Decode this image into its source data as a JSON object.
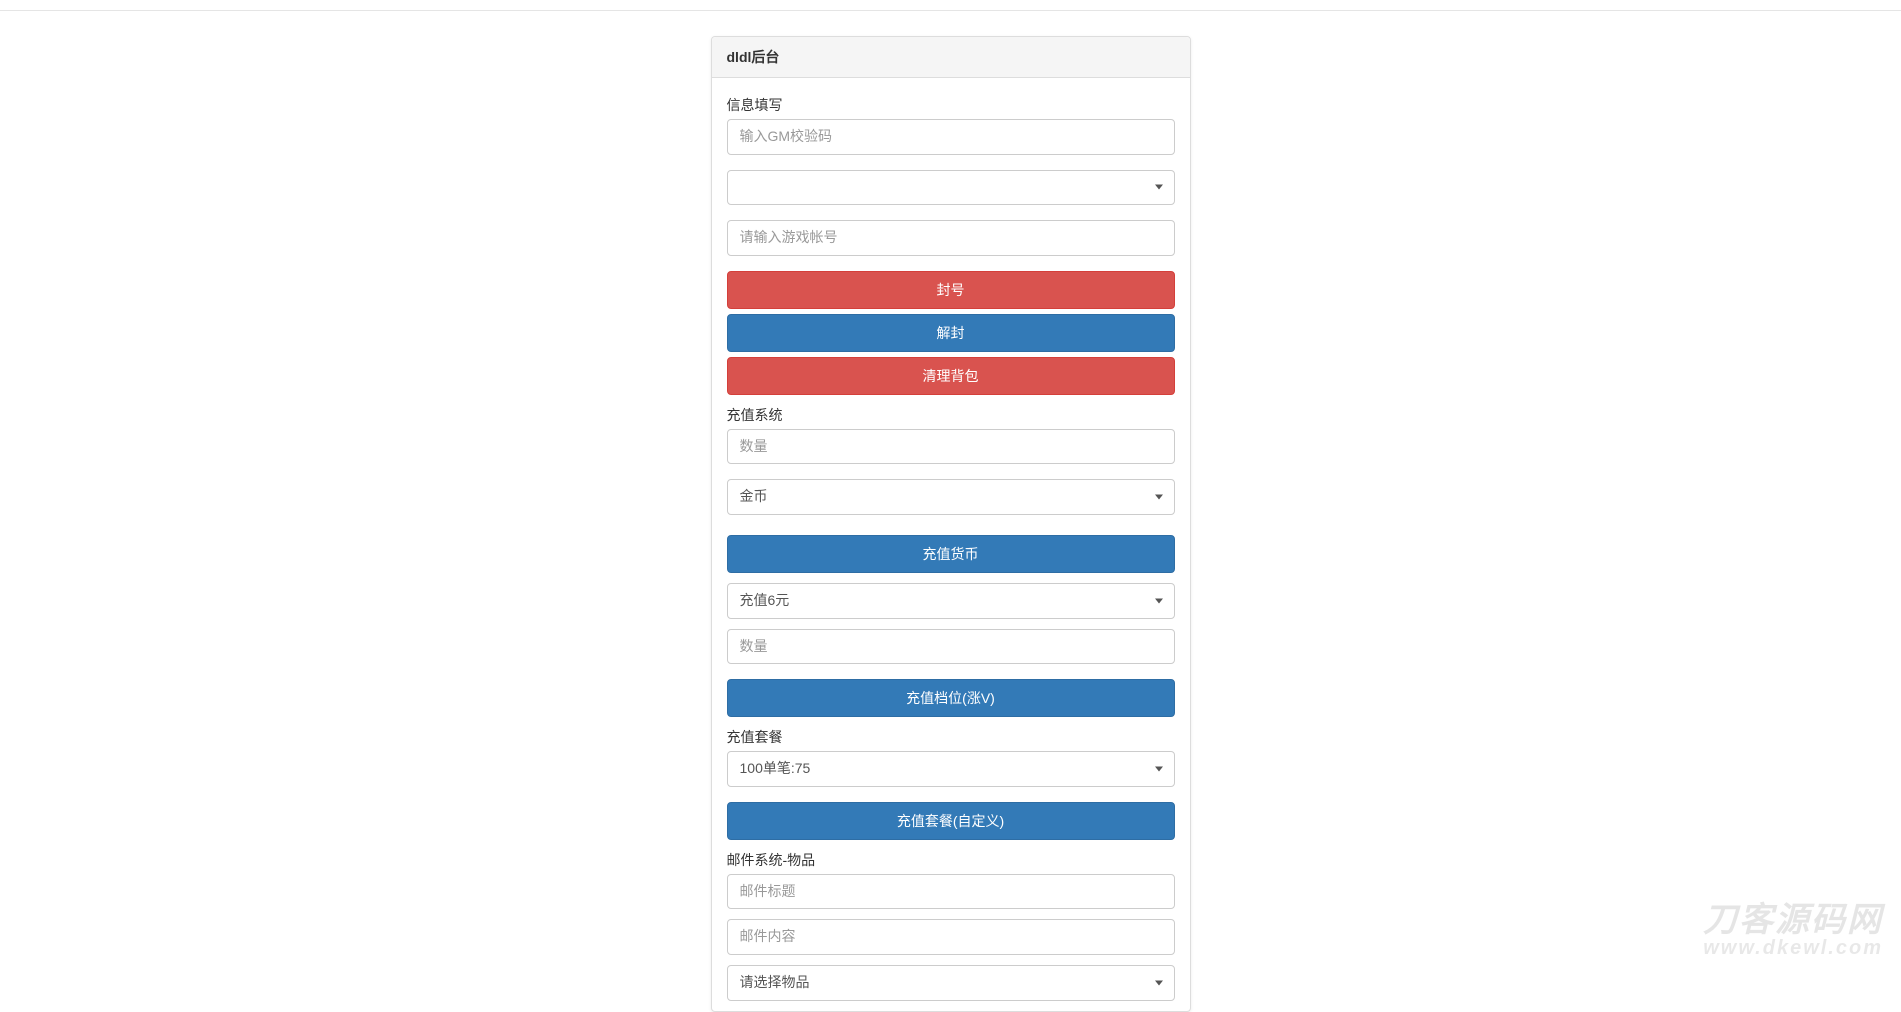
{
  "panel": {
    "title": "dldl后台"
  },
  "info": {
    "label": "信息填写",
    "gm_code_placeholder": "输入GM校验码",
    "server_selected": "",
    "account_placeholder": "请输入游戏帐号",
    "btn_ban": "封号",
    "btn_unban": "解封",
    "btn_clearbag": "清理背包"
  },
  "recharge": {
    "label": "充值系统",
    "amount_placeholder": "数量",
    "currency_selected": "金币",
    "btn_currency": "充值货币",
    "tier_selected": "充值6元",
    "tier_amount_placeholder": "数量",
    "btn_tier": "充值档位(涨V)"
  },
  "package": {
    "label": "充值套餐",
    "selected": "100单笔:75",
    "btn": "充值套餐(自定义)"
  },
  "mail": {
    "label": "邮件系统-物品",
    "title_placeholder": "邮件标题",
    "body_placeholder": "邮件内容",
    "item_selected": "请选择物品"
  },
  "watermark": {
    "line1": "刀客源码网",
    "line2": "www.dkewl.com"
  }
}
